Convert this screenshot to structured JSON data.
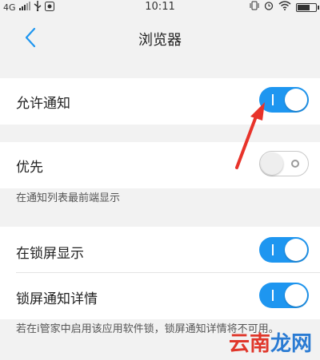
{
  "status_bar": {
    "network": "4G",
    "signal_icon": "signal-bars-icon",
    "usb_icon": "usb-icon",
    "notification_icon": "app-notification-icon",
    "time": "10:11",
    "vibrate_icon": "vibrate-icon",
    "alarm_icon": "alarm-clock-icon",
    "wifi_icon": "wifi-icon",
    "battery_icon": "battery-icon",
    "battery_level": 0.72
  },
  "header": {
    "back_icon": "chevron-left-icon",
    "title": "浏览器"
  },
  "settings": {
    "allow_notifications": {
      "label": "允许通知",
      "enabled": true
    },
    "priority": {
      "label": "优先",
      "enabled": false,
      "hint": "在通知列表最前端显示"
    },
    "show_on_lockscreen": {
      "label": "在锁屏显示",
      "enabled": true
    },
    "lockscreen_details": {
      "label": "锁屏通知详情",
      "enabled": true
    },
    "footer_hint": "若在i管家中启用该应用软件锁，锁屏通知详情将不可用。"
  },
  "annotation": {
    "arrow_color": "#e8332a"
  },
  "watermark": {
    "part1": "云南",
    "part2": "龙网"
  },
  "colors": {
    "toggle_on": "#1e96f0",
    "accent": "#1e96f0"
  }
}
